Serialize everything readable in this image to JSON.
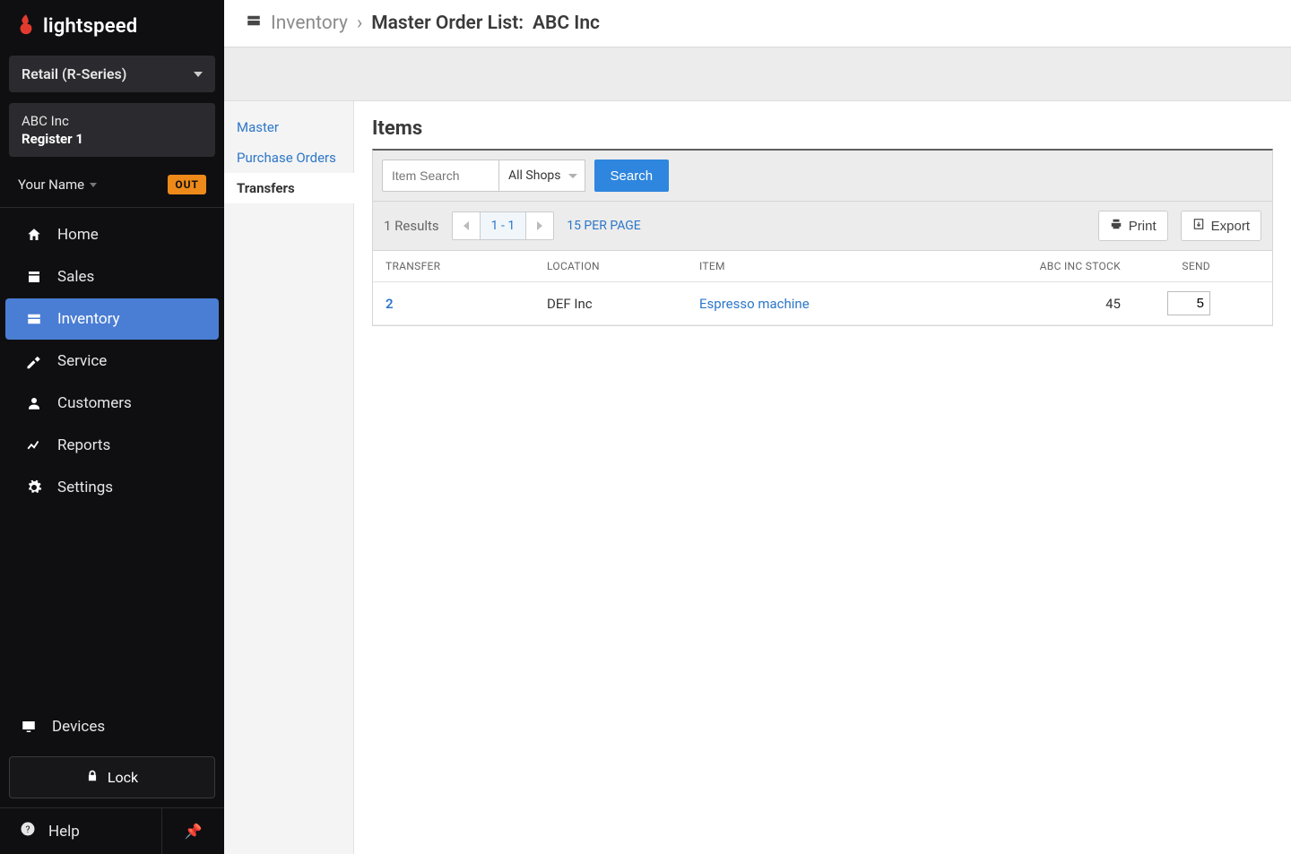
{
  "brand": {
    "name": "lightspeed"
  },
  "productSelector": {
    "label": "Retail (R-Series)"
  },
  "account": {
    "company": "ABC Inc",
    "register": "Register 1"
  },
  "user": {
    "name": "Your Name",
    "out_badge": "OUT"
  },
  "nav": {
    "home": "Home",
    "sales": "Sales",
    "inventory": "Inventory",
    "service": "Service",
    "customers": "Customers",
    "reports": "Reports",
    "settings": "Settings",
    "devices": "Devices",
    "lock": "Lock",
    "help": "Help"
  },
  "breadcrumb": {
    "root": "Inventory",
    "page": "Master Order List:",
    "context": "ABC Inc"
  },
  "subnav": {
    "master": "Master",
    "purchase_orders": "Purchase Orders",
    "transfers": "Transfers"
  },
  "items": {
    "heading": "Items",
    "search_placeholder": "Item Search",
    "shop_filter": "All Shops",
    "search_button": "Search",
    "results_count": "1 Results",
    "pager_range": "1 - 1",
    "per_page": "15 PER PAGE",
    "print": "Print",
    "export": "Export",
    "columns": {
      "transfer": "TRANSFER",
      "location": "LOCATION",
      "item": "ITEM",
      "stock": "ABC INC STOCK",
      "send": "SEND"
    },
    "rows": [
      {
        "transfer": "2",
        "location": "DEF Inc",
        "item": "Espresso machine",
        "stock": "45",
        "send": "5"
      }
    ]
  }
}
